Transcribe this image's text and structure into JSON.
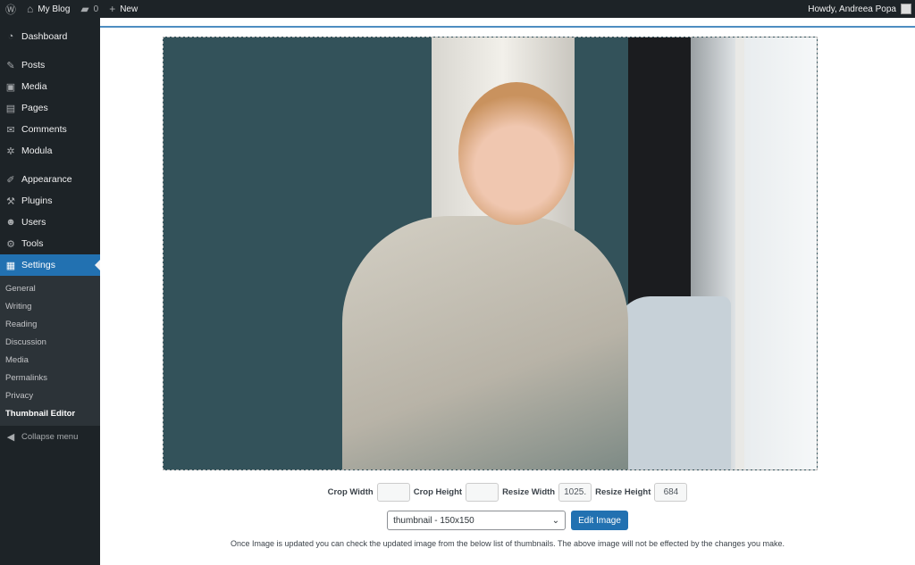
{
  "topbar": {
    "site": "My Blog",
    "comments": "0",
    "new": "New",
    "howdy": "Howdy, Andreea Popa"
  },
  "sidebar": {
    "items": [
      {
        "label": "Dashboard",
        "icon": "◔"
      },
      {
        "label": "Posts",
        "icon": "✎"
      },
      {
        "label": "Media",
        "icon": "▣"
      },
      {
        "label": "Pages",
        "icon": "▤"
      },
      {
        "label": "Comments",
        "icon": "✉"
      },
      {
        "label": "Modula",
        "icon": "✲"
      },
      {
        "label": "Appearance",
        "icon": "✐"
      },
      {
        "label": "Plugins",
        "icon": "⚒"
      },
      {
        "label": "Users",
        "icon": "☻"
      },
      {
        "label": "Tools",
        "icon": "⚙"
      },
      {
        "label": "Settings",
        "icon": "▦"
      }
    ],
    "submenu": [
      "General",
      "Writing",
      "Reading",
      "Discussion",
      "Media",
      "Permalinks",
      "Privacy",
      "Thumbnail Editor"
    ],
    "collapse": "Collapse menu"
  },
  "editor": {
    "crop_width_label": "Crop Width",
    "crop_width": "",
    "crop_height_label": "Crop Height",
    "crop_height": "",
    "resize_width_label": "Resize Width",
    "resize_width": "1025.",
    "resize_height_label": "Resize Height",
    "resize_height": "684",
    "size_select": "thumbnail - 150x150",
    "edit_button": "Edit Image",
    "note": "Once Image is updated you can check the updated image from the below list of thumbnails. The above image will not be effected by the changes you make."
  },
  "colors": {
    "accent": "#2271b1",
    "admin_bar": "#1d2327"
  }
}
